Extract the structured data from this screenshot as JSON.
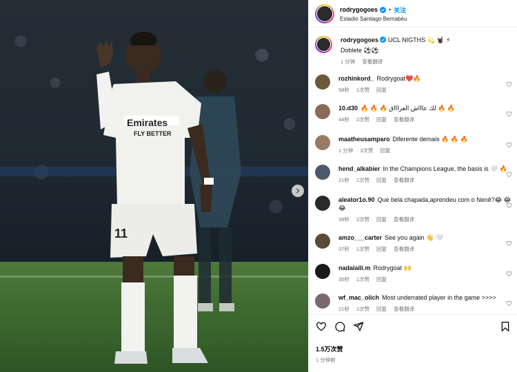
{
  "post": {
    "username": "rodrygogoes",
    "follow_label": "关注",
    "location": "Estadio Santiago Bernabéu",
    "likes": "1.5万次赞",
    "time": "1 分钟前"
  },
  "caption": {
    "username": "rodrygogoes",
    "text_line1": "UCL NIGTHS 💫 🤘🏿 ⚡",
    "text_line2": "Doblete ⚽⚽",
    "time": "1 分钟",
    "translate": "查看翻译"
  },
  "comments": [
    {
      "user": "rozhinkord_",
      "text": "Rodrygoat❤️🔥",
      "time": "58秒",
      "likes": "1次赞",
      "reply": "回复",
      "translate": "",
      "avatar_color": "#6b5a3a"
    },
    {
      "user": "10.d30",
      "text": "🔥 🔥 🔥 لك عاااش العراااق 🔥 🔥",
      "time": "44秒",
      "likes": "2次赞",
      "reply": "回复",
      "translate": "查看翻译",
      "avatar_color": "#8a6a58"
    },
    {
      "user": "maatheusamparo",
      "text": "Diferente demais 🔥 🔥 🔥",
      "time": "1 分钟",
      "likes": "3次赞",
      "reply": "回复",
      "translate": "",
      "avatar_color": "#9a7a60"
    },
    {
      "user": "hend_alkabier",
      "text": "In the Champions League, the basis is 🤍 🔥",
      "time": "21秒",
      "likes": "1次赞",
      "reply": "回复",
      "translate": "查看翻译",
      "avatar_color": "#4a5a6a"
    },
    {
      "user": "aleator1o.90",
      "text": "Que bela chapada,aprendeu com o Nenê?😂 😂 😂",
      "time": "39秒",
      "likes": "2次赞",
      "reply": "回复",
      "translate": "查看翻译",
      "avatar_color": "#2a2a2a"
    },
    {
      "user": "amzo___carter",
      "text": "See you again 👋 🤍",
      "time": "37秒",
      "likes": "1次赞",
      "reply": "回复",
      "translate": "查看翻译",
      "avatar_color": "#5a4a3a"
    },
    {
      "user": "nadalaili.m",
      "text": "Rodrygoat 🙌",
      "time": "35秒",
      "likes": "1次赞",
      "reply": "回复",
      "translate": "",
      "avatar_color": "#1a1a1a"
    },
    {
      "user": "wf_mac_olich",
      "text": "Most underrated player in the game >>>>",
      "time": "21秒",
      "likes": "1次赞",
      "reply": "回复",
      "translate": "查看翻译",
      "avatar_color": "#7a6a70"
    }
  ],
  "icons": [
    "heart-icon",
    "comment-icon",
    "share-icon",
    "bookmark-icon",
    "verified-icon",
    "chevron-right-icon"
  ],
  "colors": {
    "link": "#0095f6",
    "muted": "#737373",
    "verified": "#0095f6"
  }
}
